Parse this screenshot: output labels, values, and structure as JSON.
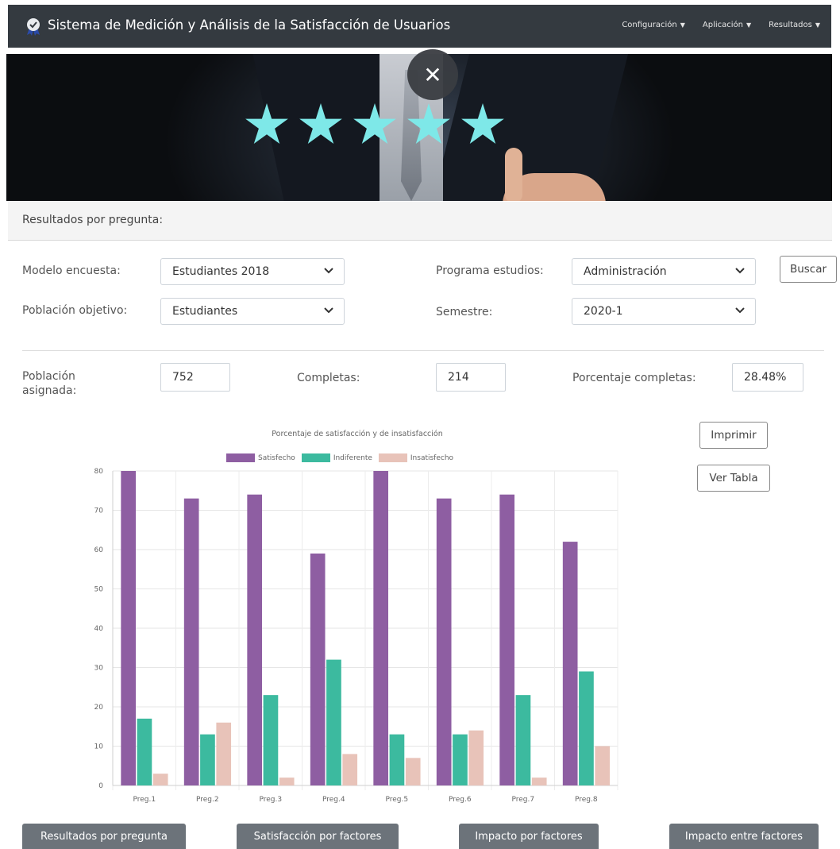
{
  "app": {
    "title": "Sistema de Medición y Análisis de la Satisfacción de Usuarios",
    "menu": [
      {
        "label": "Configuración"
      },
      {
        "label": "Aplicación"
      },
      {
        "label": "Resultados"
      }
    ]
  },
  "banner": {
    "close_symbol": "✕",
    "stars": 5
  },
  "section": {
    "title": "Resultados por pregunta:"
  },
  "filters": {
    "modelo_label": "Modelo encuesta:",
    "modelo_value": "Estudiantes 2018",
    "poblacion_label": "Población objetivo:",
    "poblacion_value": "Estudiantes",
    "programa_label": "Programa estudios:",
    "programa_value": "Administración",
    "semestre_label": "Semestre:",
    "semestre_value": "2020-1",
    "buscar_label": "Buscar"
  },
  "stats": {
    "asignada_label_1": "Población",
    "asignada_label_2": "asignada:",
    "asignada_value": "752",
    "completas_label": "Completas:",
    "completas_value": "214",
    "porcentaje_label": "Porcentaje completas:",
    "porcentaje_value": "28.48%"
  },
  "actions": {
    "imprimir_label": "Imprimir",
    "ver_tabla_label": "Ver Tabla"
  },
  "chart_data": {
    "type": "bar",
    "title": "Porcentaje de satisfacción y de insatisfacción",
    "categories": [
      "Preg.1",
      "Preg.2",
      "Preg.3",
      "Preg.4",
      "Preg.5",
      "Preg.6",
      "Preg.7",
      "Preg.8"
    ],
    "series": [
      {
        "name": "Satisfecho",
        "color": "#8e5ea2",
        "values": [
          80,
          73,
          74,
          59,
          80,
          73,
          74,
          62
        ]
      },
      {
        "name": "Indiferente",
        "color": "#3cba9f",
        "values": [
          17,
          13,
          23,
          32,
          13,
          13,
          23,
          29
        ]
      },
      {
        "name": "Insatisfecho",
        "color": "#e8c3b9",
        "values": [
          3,
          16,
          2,
          8,
          7,
          14,
          2,
          10
        ]
      }
    ],
    "ylim": [
      0,
      80
    ],
    "yticks": [
      0,
      10,
      20,
      30,
      40,
      50,
      60,
      70,
      80
    ],
    "legend": "top",
    "grid": true
  },
  "footer_buttons": [
    {
      "label": "Resultados por pregunta"
    },
    {
      "label": "Satisfacción por factores"
    },
    {
      "label": "Impacto por factores"
    },
    {
      "label": "Impacto entre factores"
    }
  ]
}
